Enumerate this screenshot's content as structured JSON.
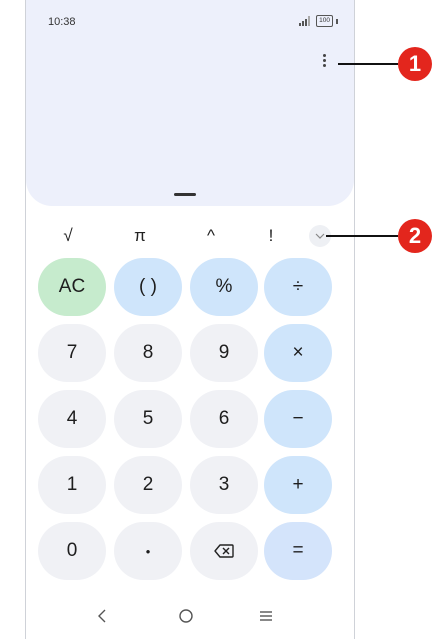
{
  "status_bar": {
    "time": "10:38",
    "battery": "100"
  },
  "functions": {
    "sqrt": "√",
    "pi": "π",
    "power": "^",
    "factorial": "!"
  },
  "keys": {
    "ac": "AC",
    "parens": "( )",
    "percent": "%",
    "divide": "÷",
    "seven": "7",
    "eight": "8",
    "nine": "9",
    "multiply": "×",
    "four": "4",
    "five": "5",
    "six": "6",
    "minus": "−",
    "one": "1",
    "two": "2",
    "three": "3",
    "plus": "+",
    "zero": "0",
    "decimal": "•",
    "equals": "="
  },
  "callouts": [
    "1",
    "2"
  ],
  "colors": {
    "display_bg": "#edf0fb",
    "number_key": "#f0f1f5",
    "operator_key": "#cfe5fb",
    "clear_key": "#c6ebcd",
    "equals_key": "#d4e4fb",
    "callout": "#e3261d"
  },
  "icons": [
    "signal-icon",
    "battery-icon",
    "more-vert-icon",
    "chevron-down-icon",
    "backspace-icon",
    "back-icon",
    "home-icon",
    "recents-icon"
  ]
}
